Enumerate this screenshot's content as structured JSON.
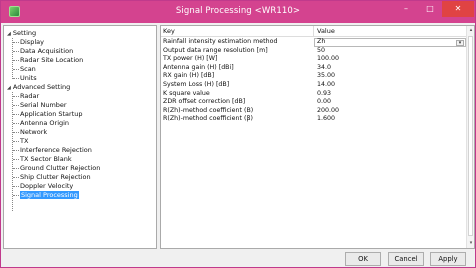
{
  "window": {
    "title": "Signal Processing <WR110>",
    "min_glyph": "–",
    "max_glyph": "□",
    "close_glyph": "✕",
    "accent": "#d4438f",
    "close_color": "#e04343",
    "selection_color": "#3399ff"
  },
  "tree": {
    "setting": {
      "label": "Setting",
      "expander": "◢"
    },
    "setting_children": [
      "Display",
      "Data Acquisition",
      "Radar Site Location",
      "Scan",
      "Units"
    ],
    "advanced": {
      "label": "Advanced Setting",
      "expander": "◢"
    },
    "advanced_children": [
      "Radar",
      "Serial Number",
      "Application Startup",
      "Antenna Origin",
      "Network",
      "TX",
      "Interference Rejection",
      "TX Sector Blank",
      "Ground Clutter Rejection",
      "Ship Clutter Rejection",
      "Doppler Velocity",
      "Signal Processing"
    ],
    "selected": "Signal Processing"
  },
  "grid": {
    "header_key": "Key",
    "header_value": "Value",
    "rows": [
      {
        "key": "Rainfall intensity estimation method",
        "value": "Zh"
      },
      {
        "key": "Output data range resolution [m]",
        "value": "50"
      },
      {
        "key": "TX power (H) [W]",
        "value": "100.00"
      },
      {
        "key": "Antenna gain (H) [dBi]",
        "value": "34.0"
      },
      {
        "key": "RX gain (H) [dB]",
        "value": "35.00"
      },
      {
        "key": "System Loss (H) [dB]",
        "value": "14.00"
      },
      {
        "key": "K square value",
        "value": "0.93"
      },
      {
        "key": "ZDR offset correction [dB]",
        "value": "0.00"
      },
      {
        "key": "R(Zh)-method coefficient (B)",
        "value": "200.00"
      },
      {
        "key": "R(Zh)-method coefficient (β)",
        "value": "1.600"
      }
    ],
    "dropdown_glyph": "▾",
    "scroll_up_glyph": "▴",
    "scroll_down_glyph": "▾"
  },
  "buttons": {
    "ok": "OK",
    "cancel": "Cancel",
    "apply": "Apply"
  }
}
